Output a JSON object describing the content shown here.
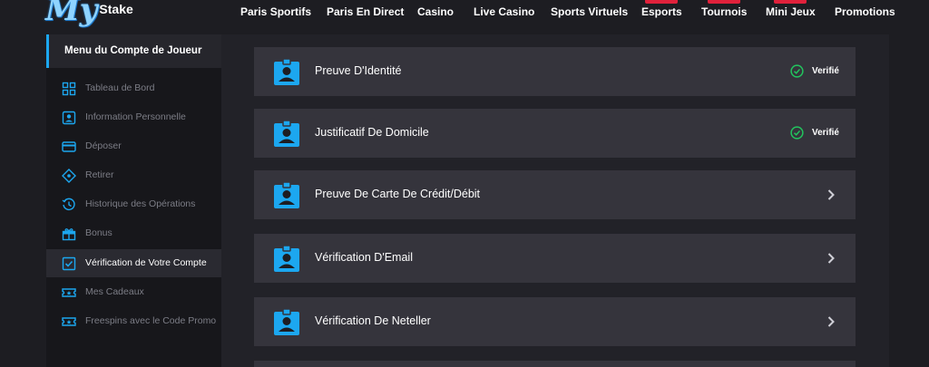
{
  "brand": {
    "logo_main": "My",
    "logo_sub": "Stake"
  },
  "nav": {
    "items": [
      {
        "label": "Paris Sportifs",
        "badge": false
      },
      {
        "label": "Paris En Direct",
        "badge": false
      },
      {
        "label": "Casino",
        "badge": false
      },
      {
        "label": "Live Casino",
        "badge": false
      },
      {
        "label": "Sports Virtuels",
        "badge": false
      },
      {
        "label": "Esports",
        "badge": true
      },
      {
        "label": "Tournois",
        "badge": true
      },
      {
        "label": "Mini Jeux",
        "badge": true
      },
      {
        "label": "Promotions",
        "badge": false
      }
    ]
  },
  "sidebar": {
    "title": "Menu du Compte de Joueur",
    "items": [
      {
        "label": "Tableau de Bord",
        "icon": "dashboard-icon"
      },
      {
        "label": "Information Personnelle",
        "icon": "id-card-icon"
      },
      {
        "label": "Déposer",
        "icon": "credit-card-icon"
      },
      {
        "label": "Retirer",
        "icon": "withdraw-icon"
      },
      {
        "label": "Historique des Opérations",
        "icon": "history-icon"
      },
      {
        "label": "Bonus",
        "icon": "gift-icon"
      },
      {
        "label": "Vérification de Votre Compte",
        "icon": "checkbox-icon",
        "active": true
      },
      {
        "label": "Mes Cadeaux",
        "icon": "ticket-icon"
      },
      {
        "label": "Freespins avec le Code Promo",
        "icon": "ticket-star-icon"
      }
    ]
  },
  "main": {
    "cards": [
      {
        "label": "Preuve D'Identité",
        "status": "Verifié",
        "icon": "user-badge-icon",
        "action": "check-circle-icon"
      },
      {
        "label": "Justificatif De Domicile",
        "status": "Verifié",
        "icon": "user-badge-icon",
        "action": "check-circle-icon"
      },
      {
        "label": "Preuve De Carte De Crédit/Débit",
        "status": "",
        "icon": "user-badge-icon",
        "action": "chevron-right-icon"
      },
      {
        "label": "Vérification D'Email",
        "status": "",
        "icon": "user-badge-icon",
        "action": "chevron-right-icon"
      },
      {
        "label": "Vérification De Neteller",
        "status": "",
        "icon": "user-badge-icon",
        "action": "chevron-right-icon"
      }
    ]
  },
  "colors": {
    "accent": "#1ca7f0",
    "success": "#22c55e",
    "badge": "#e0213b",
    "card_bg": "#35343c"
  }
}
